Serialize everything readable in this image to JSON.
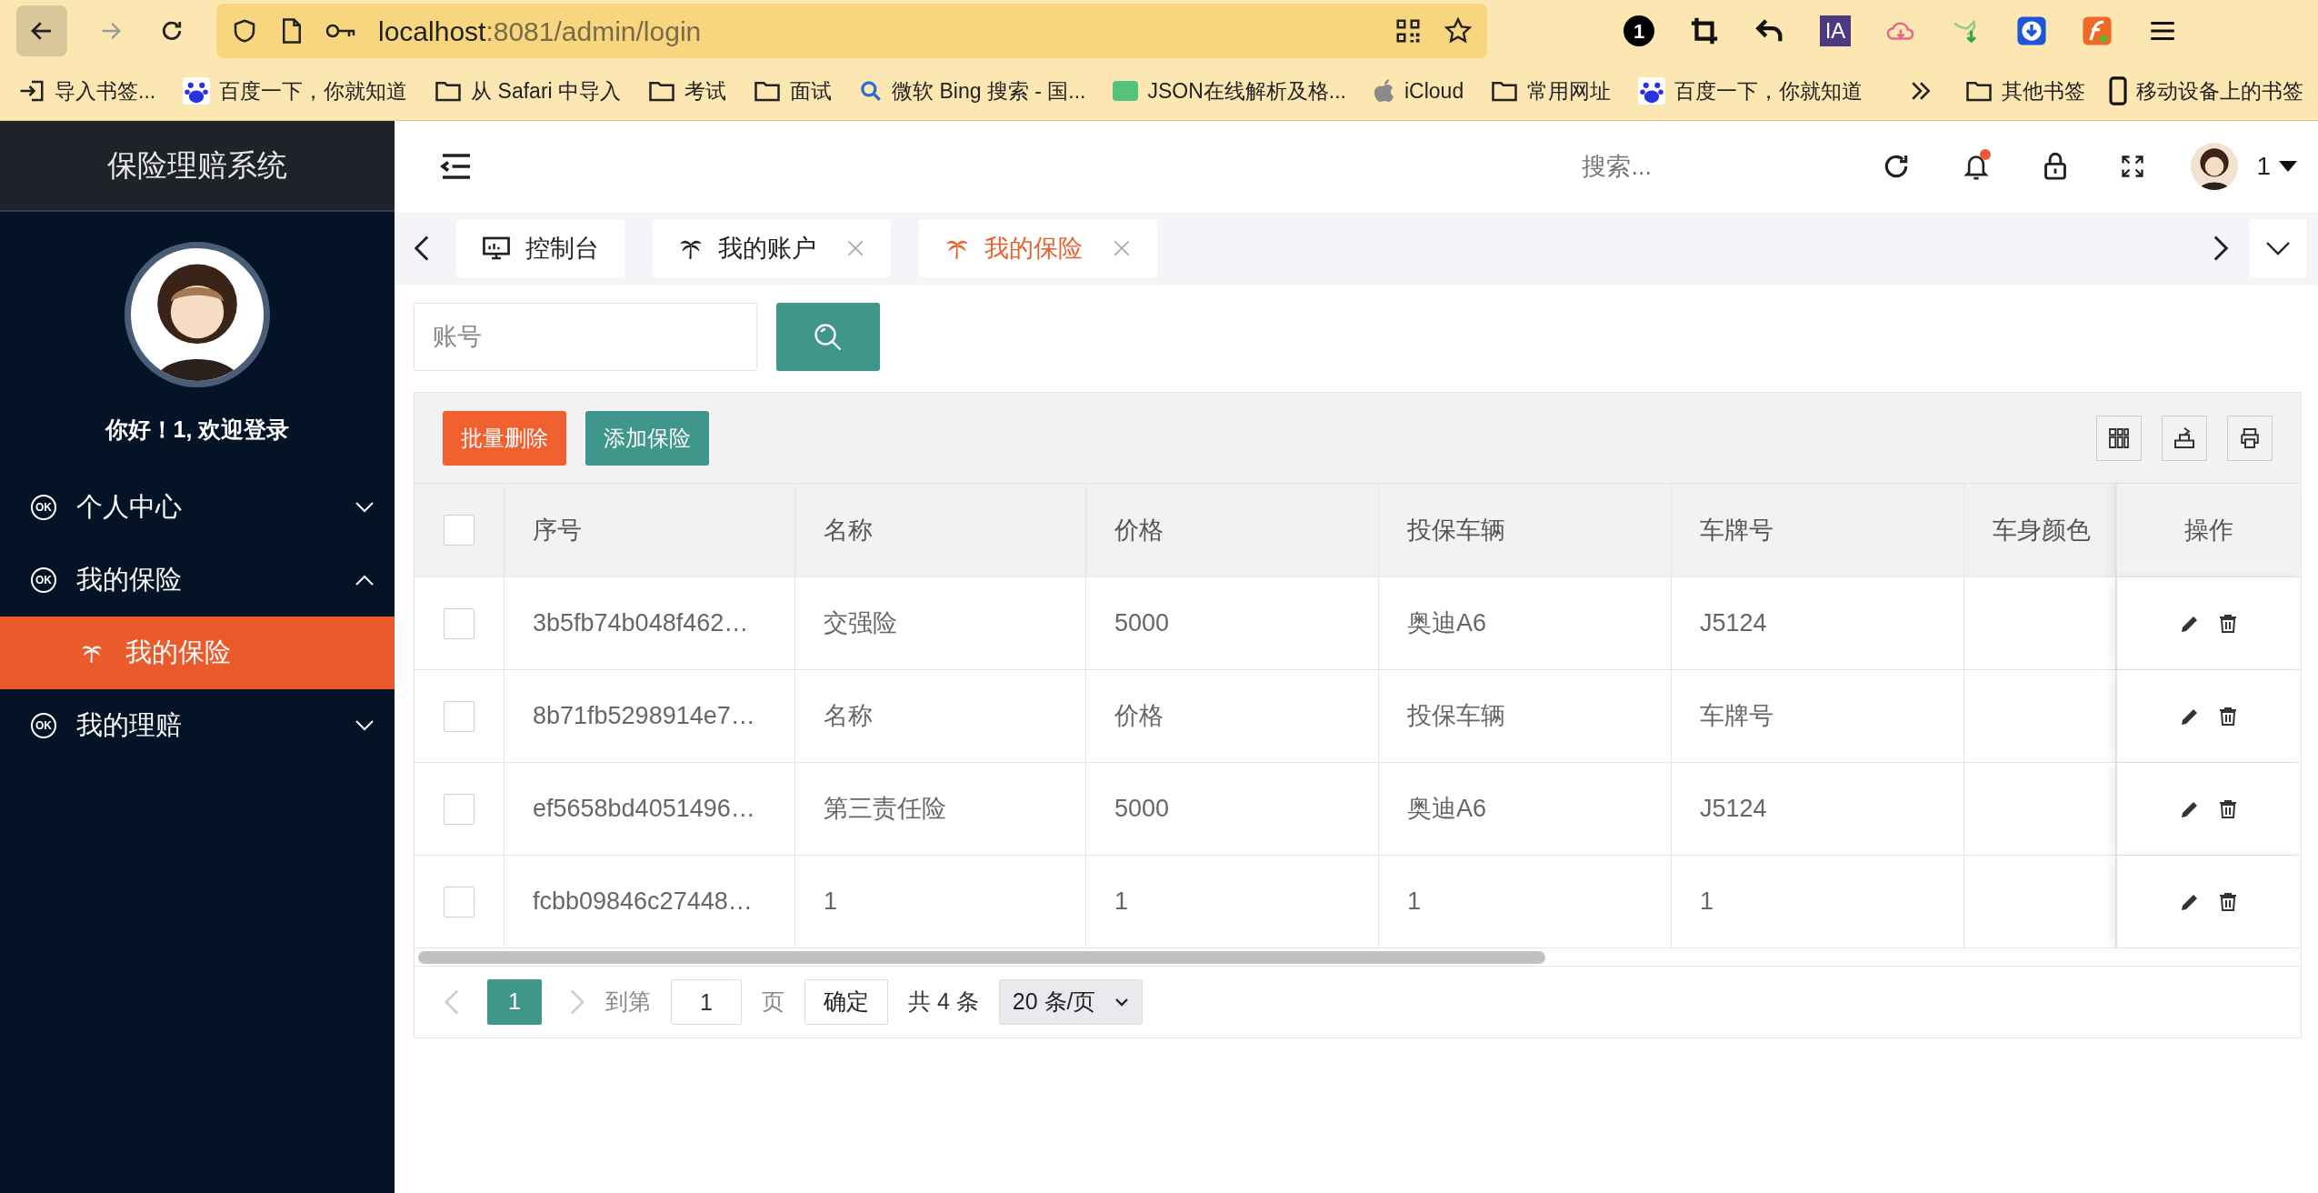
{
  "browser": {
    "url_host": "localhost",
    "url_path": ":8081/admin/login",
    "extensions": [
      {
        "kind": "badge",
        "text": "1"
      },
      {
        "kind": "crop"
      },
      {
        "kind": "undo"
      },
      {
        "kind": "label",
        "text": "IA"
      },
      {
        "kind": "cloud"
      },
      {
        "kind": "bird"
      },
      {
        "kind": "download"
      },
      {
        "kind": "flash"
      }
    ],
    "bookmarks": [
      {
        "label": "导入书签...",
        "kind": "import"
      },
      {
        "label": "百度一下，你就知道",
        "kind": "paw"
      },
      {
        "label": "从 Safari 中导入",
        "kind": "folder"
      },
      {
        "label": "考试",
        "kind": "folder"
      },
      {
        "label": "面试",
        "kind": "folder"
      },
      {
        "label": "微软 Bing 搜索 - 国...",
        "kind": "search"
      },
      {
        "label": "JSON在线解析及格...",
        "kind": "json"
      },
      {
        "label": "iCloud",
        "kind": "apple"
      },
      {
        "label": "常用网址",
        "kind": "folder"
      },
      {
        "label": "百度一下，你就知道",
        "kind": "paw"
      }
    ],
    "bookmarks_right": [
      {
        "label": "其他书签",
        "kind": "folder"
      },
      {
        "label": "移动设备上的书签",
        "kind": "phone"
      }
    ]
  },
  "sidebar": {
    "title": "保险理赔系统",
    "greeting": "你好！1, 欢迎登录",
    "menu": [
      {
        "badge": "OK",
        "label": "个人中心",
        "expanded": false
      },
      {
        "badge": "OK",
        "label": "我的保险",
        "expanded": true,
        "children": [
          {
            "label": "我的保险",
            "selected": true
          }
        ]
      },
      {
        "badge": "OK",
        "label": "我的理赔",
        "expanded": false
      }
    ]
  },
  "header": {
    "search_placeholder": "搜索...",
    "user": "1",
    "notification": true
  },
  "tabs": [
    {
      "label": "控制台",
      "kind": "dashboard",
      "selected": false,
      "closable": false
    },
    {
      "label": "我的账户",
      "kind": "page",
      "selected": false,
      "closable": true
    },
    {
      "label": "我的保险",
      "kind": "page",
      "selected": true,
      "closable": true
    }
  ],
  "search": {
    "placeholder": "账号"
  },
  "actions": [
    {
      "label": "批量删除",
      "kind": "danger"
    },
    {
      "label": "添加保险",
      "kind": "primary"
    }
  ],
  "table": {
    "header_checked": false,
    "columns": [
      "序号",
      "名称",
      "价格",
      "投保车辆",
      "车牌号",
      "车身颜色",
      "操作"
    ],
    "rows": [
      {
        "checked": false,
        "cells": [
          "3b5fb74b048f462…",
          "交强险",
          "5000",
          "奥迪A6",
          "J5124",
          ""
        ]
      },
      {
        "checked": false,
        "cells": [
          "8b71fb5298914e7…",
          "名称",
          "价格",
          "投保车辆",
          "车牌号",
          ""
        ]
      },
      {
        "checked": false,
        "cells": [
          "ef5658bd4051496…",
          "第三责任险",
          "5000",
          "奥迪A6",
          "J5124",
          ""
        ]
      },
      {
        "checked": false,
        "cells": [
          "fcbb09846c27448…",
          "1",
          "1",
          "1",
          "1",
          ""
        ]
      }
    ]
  },
  "pagination": {
    "pages": [
      {
        "label": "1",
        "selected": true
      }
    ],
    "goto_label": "到第",
    "goto_value": "1",
    "page_unit": "页",
    "confirm": "确定",
    "total": "共 4 条",
    "page_size": "20 条/页"
  }
}
